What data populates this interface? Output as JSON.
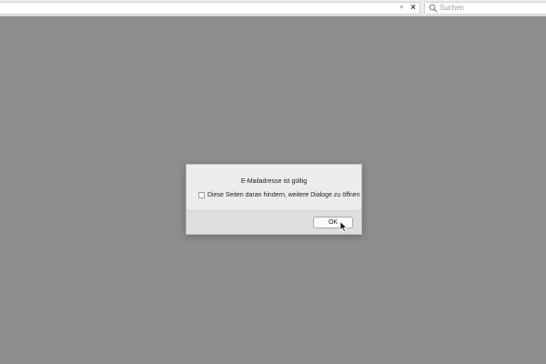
{
  "toolbar": {
    "search_placeholder": "Suchen",
    "url_stop_icon": "×",
    "url_dropdown_icon": "▾"
  },
  "dialog": {
    "message": "E-Mailadresse ist gültig",
    "checkbox_label": "Diese Seiten daran hindern, weitere Dialoge zu öffnen",
    "checkbox_checked": false,
    "ok_label": "OK"
  },
  "icons": {
    "search": "search-icon",
    "stop": "close-icon",
    "dropdown": "chevron-down-icon",
    "cursor": "mouse-pointer-icon"
  },
  "colors": {
    "overlay_background": "#8e8e8e",
    "dialog_background": "#ececec",
    "dialog_footer": "#dedede"
  }
}
